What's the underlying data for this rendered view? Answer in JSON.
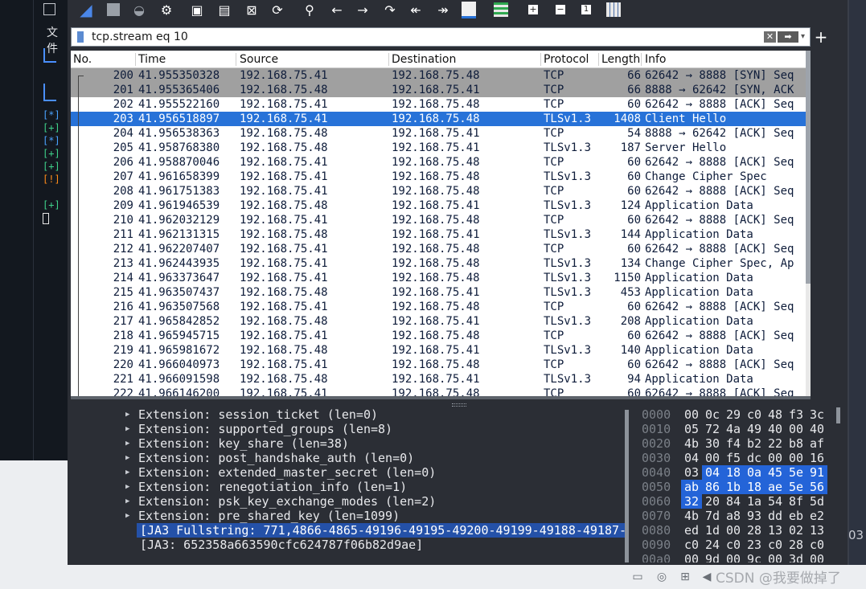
{
  "left_panel": {
    "menu_label": "文件",
    "markers": [
      "[*]",
      "[+]",
      "[*]",
      "[+]",
      "[+]",
      "[!]",
      "[+]"
    ],
    "marker_colors": {
      "*": "#4aa3ff",
      "+": "#3fd18a",
      "!": "#ff8c1a"
    }
  },
  "filter": {
    "value": "tcp.stream eq 10"
  },
  "packet_list": {
    "columns": [
      "No.",
      "Time",
      "Source",
      "Destination",
      "Protocol",
      "Length",
      "Info"
    ],
    "rows": [
      {
        "no": "200",
        "time": "41.955350328",
        "src": "192.168.75.41",
        "dst": "192.168.75.48",
        "proto": "TCP",
        "len": "66",
        "info": "62642 → 8888 [SYN] Seq",
        "style": "g"
      },
      {
        "no": "201",
        "time": "41.955365406",
        "src": "192.168.75.48",
        "dst": "192.168.75.41",
        "proto": "TCP",
        "len": "66",
        "info": "8888 → 62642 [SYN, ACK",
        "style": "g"
      },
      {
        "no": "202",
        "time": "41.955522160",
        "src": "192.168.75.41",
        "dst": "192.168.75.48",
        "proto": "TCP",
        "len": "60",
        "info": "62642 → 8888 [ACK] Seq",
        "style": ""
      },
      {
        "no": "203",
        "time": "41.956518897",
        "src": "192.168.75.41",
        "dst": "192.168.75.48",
        "proto": "TLSv1.3",
        "len": "1408",
        "info": "Client Hello",
        "style": "s"
      },
      {
        "no": "204",
        "time": "41.956538363",
        "src": "192.168.75.48",
        "dst": "192.168.75.41",
        "proto": "TCP",
        "len": "54",
        "info": "8888 → 62642 [ACK] Seq",
        "style": ""
      },
      {
        "no": "205",
        "time": "41.958768380",
        "src": "192.168.75.48",
        "dst": "192.168.75.41",
        "proto": "TLSv1.3",
        "len": "187",
        "info": "Server Hello",
        "style": ""
      },
      {
        "no": "206",
        "time": "41.958870046",
        "src": "192.168.75.41",
        "dst": "192.168.75.48",
        "proto": "TCP",
        "len": "60",
        "info": "62642 → 8888 [ACK] Seq",
        "style": ""
      },
      {
        "no": "207",
        "time": "41.961658399",
        "src": "192.168.75.41",
        "dst": "192.168.75.48",
        "proto": "TLSv1.3",
        "len": "60",
        "info": "Change Cipher Spec",
        "style": ""
      },
      {
        "no": "208",
        "time": "41.961751383",
        "src": "192.168.75.41",
        "dst": "192.168.75.48",
        "proto": "TCP",
        "len": "60",
        "info": "62642 → 8888 [ACK] Seq",
        "style": ""
      },
      {
        "no": "209",
        "time": "41.961946539",
        "src": "192.168.75.48",
        "dst": "192.168.75.41",
        "proto": "TLSv1.3",
        "len": "124",
        "info": "Application Data",
        "style": ""
      },
      {
        "no": "210",
        "time": "41.962032129",
        "src": "192.168.75.41",
        "dst": "192.168.75.48",
        "proto": "TCP",
        "len": "60",
        "info": "62642 → 8888 [ACK] Seq",
        "style": ""
      },
      {
        "no": "211",
        "time": "41.962131315",
        "src": "192.168.75.48",
        "dst": "192.168.75.41",
        "proto": "TLSv1.3",
        "len": "144",
        "info": "Application Data",
        "style": ""
      },
      {
        "no": "212",
        "time": "41.962207407",
        "src": "192.168.75.41",
        "dst": "192.168.75.48",
        "proto": "TCP",
        "len": "60",
        "info": "62642 → 8888 [ACK] Seq",
        "style": ""
      },
      {
        "no": "213",
        "time": "41.962443935",
        "src": "192.168.75.41",
        "dst": "192.168.75.48",
        "proto": "TLSv1.3",
        "len": "134",
        "info": "Change Cipher Spec, Ap",
        "style": ""
      },
      {
        "no": "214",
        "time": "41.963373647",
        "src": "192.168.75.41",
        "dst": "192.168.75.48",
        "proto": "TLSv1.3",
        "len": "1150",
        "info": "Application Data",
        "style": ""
      },
      {
        "no": "215",
        "time": "41.963507437",
        "src": "192.168.75.48",
        "dst": "192.168.75.41",
        "proto": "TLSv1.3",
        "len": "453",
        "info": "Application Data",
        "style": ""
      },
      {
        "no": "216",
        "time": "41.963507568",
        "src": "192.168.75.41",
        "dst": "192.168.75.48",
        "proto": "TCP",
        "len": "60",
        "info": "62642 → 8888 [ACK] Seq",
        "style": ""
      },
      {
        "no": "217",
        "time": "41.965842852",
        "src": "192.168.75.48",
        "dst": "192.168.75.41",
        "proto": "TLSv1.3",
        "len": "208",
        "info": "Application Data",
        "style": ""
      },
      {
        "no": "218",
        "time": "41.965945715",
        "src": "192.168.75.41",
        "dst": "192.168.75.48",
        "proto": "TCP",
        "len": "60",
        "info": "62642 → 8888 [ACK] Seq",
        "style": ""
      },
      {
        "no": "219",
        "time": "41.965981672",
        "src": "192.168.75.48",
        "dst": "192.168.75.41",
        "proto": "TLSv1.3",
        "len": "140",
        "info": "Application Data",
        "style": ""
      },
      {
        "no": "220",
        "time": "41.966040973",
        "src": "192.168.75.41",
        "dst": "192.168.75.48",
        "proto": "TCP",
        "len": "60",
        "info": "62642 → 8888 [ACK] Seq",
        "style": ""
      },
      {
        "no": "221",
        "time": "41.966091598",
        "src": "192.168.75.48",
        "dst": "192.168.75.41",
        "proto": "TLSv1.3",
        "len": "94",
        "info": "Application Data",
        "style": ""
      },
      {
        "no": "222",
        "time": "41.966146200",
        "src": "192.168.75.41",
        "dst": "192.168.75.48",
        "proto": "TCP",
        "len": "60",
        "info": "62642 → 8888 [ACK] Seq",
        "style": ""
      }
    ]
  },
  "details": {
    "rows": [
      {
        "text": "Extension: session_ticket (len=0)",
        "kind": "ext"
      },
      {
        "text": "Extension: supported_groups (len=8)",
        "kind": "ext"
      },
      {
        "text": "Extension: key_share (len=38)",
        "kind": "ext"
      },
      {
        "text": "Extension: post_handshake_auth (len=0)",
        "kind": "ext"
      },
      {
        "text": "Extension: extended_master_secret (len=0)",
        "kind": "ext"
      },
      {
        "text": "Extension: renegotiation_info (len=1)",
        "kind": "ext"
      },
      {
        "text": "Extension: psk_key_exchange_modes (len=2)",
        "kind": "ext"
      },
      {
        "text": "Extension: pre_shared_key (len=1099)",
        "kind": "ext"
      },
      {
        "text": "[JA3 Fullstring: 771,4866-4865-49196-49195-49200-49199-49188-49187-",
        "kind": "sel"
      },
      {
        "text": "[JA3: 652358a663590cfc624787f06b82d9ae]",
        "kind": "plain"
      }
    ]
  },
  "hex": {
    "rows": [
      {
        "off": "0000",
        "bytes": [
          "00",
          "0c",
          "29",
          "c0",
          "48",
          "f3",
          "3c"
        ],
        "hl": []
      },
      {
        "off": "0010",
        "bytes": [
          "05",
          "72",
          "4a",
          "49",
          "40",
          "00",
          "40"
        ],
        "hl": []
      },
      {
        "off": "0020",
        "bytes": [
          "4b",
          "30",
          "f4",
          "b2",
          "22",
          "b8",
          "af"
        ],
        "hl": []
      },
      {
        "off": "0030",
        "bytes": [
          "04",
          "00",
          "f5",
          "dc",
          "00",
          "00",
          "16"
        ],
        "hl": []
      },
      {
        "off": "0040",
        "bytes": [
          "03",
          "04",
          "18",
          "0a",
          "45",
          "5e",
          "91"
        ],
        "hl": [
          1,
          2,
          3,
          4,
          5,
          6
        ]
      },
      {
        "off": "0050",
        "bytes": [
          "ab",
          "86",
          "1b",
          "18",
          "ae",
          "5e",
          "56"
        ],
        "hl": [
          0,
          1,
          2,
          3,
          4,
          5,
          6
        ]
      },
      {
        "off": "0060",
        "bytes": [
          "32",
          "20",
          "84",
          "1a",
          "54",
          "8f",
          "5d"
        ],
        "hl": [
          0
        ]
      },
      {
        "off": "0070",
        "bytes": [
          "4b",
          "7d",
          "a8",
          "93",
          "dd",
          "eb",
          "e2"
        ],
        "hl": []
      },
      {
        "off": "0080",
        "bytes": [
          "ed",
          "1d",
          "00",
          "28",
          "13",
          "02",
          "13"
        ],
        "hl": []
      },
      {
        "off": "0090",
        "bytes": [
          "c0",
          "24",
          "c0",
          "23",
          "c0",
          "28",
          "c0"
        ],
        "hl": []
      },
      {
        "off": "00a0",
        "bytes": [
          "00",
          "9d",
          "00",
          "9c",
          "00",
          "3d",
          "00"
        ],
        "hl": []
      }
    ]
  },
  "right_strip": {
    "text": "03"
  },
  "statusbar": {
    "watermark": "CSDN @我要做掉了"
  },
  "colors": {
    "selection": "#2772d8",
    "greyed_rows": "#a0a0a0",
    "hex_highlight": "#2464d8",
    "detail_selection": "#2451a8"
  }
}
